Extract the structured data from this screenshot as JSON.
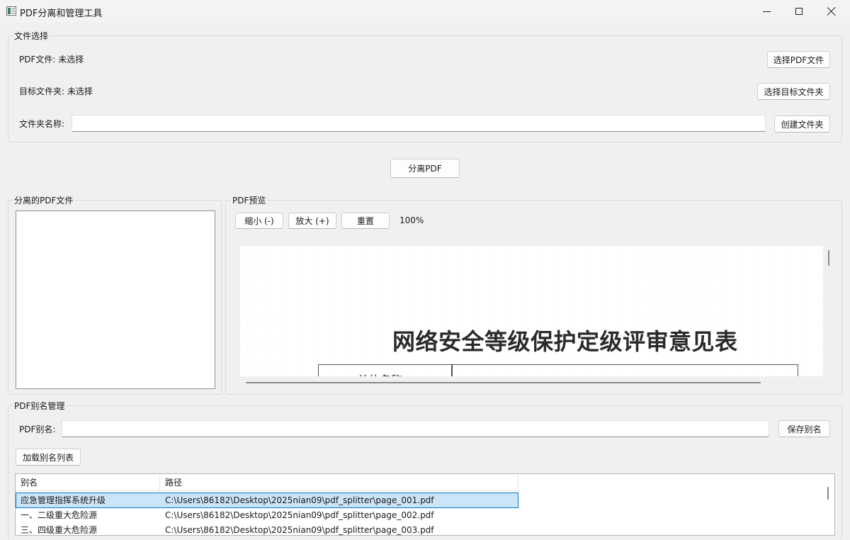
{
  "window": {
    "title": "PDF分离和管理工具"
  },
  "file_select": {
    "group_title": "文件选择",
    "pdf_file_label": "PDF文件: 未选择",
    "select_pdf_button": "选择PDF文件",
    "target_folder_label": "目标文件夹: 未选择",
    "select_target_button": "选择目标文件夹",
    "folder_name_label": "文件夹名称:",
    "folder_name_value": "",
    "create_folder_button": "创建文件夹"
  },
  "split_button": "分离PDF",
  "split_files": {
    "group_title": "分离的PDF文件",
    "items": []
  },
  "preview": {
    "group_title": "PDF预览",
    "zoom_out_button": "缩小 (-)",
    "zoom_in_button": "放大 (+)",
    "reset_button": "重置",
    "zoom_level": "100%",
    "document_title": "网络安全等级保护定级评审意见表",
    "document_cell_partial": "单位名称"
  },
  "alias": {
    "group_title": "PDF别名管理",
    "alias_label": "PDF别名:",
    "alias_value": "",
    "save_alias_button": "保存别名",
    "load_list_button": "加载别名列表",
    "table": {
      "columns": [
        "别名",
        "路径"
      ],
      "rows": [
        {
          "alias": "应急管理指挥系统升级",
          "path": "C:\\Users\\86182\\Desktop\\2025nian09\\pdf_splitter\\page_001.pdf",
          "selected": true
        },
        {
          "alias": "一、二级重大危险源",
          "path": "C:\\Users\\86182\\Desktop\\2025nian09\\pdf_splitter\\page_002.pdf",
          "selected": false
        },
        {
          "alias": "三、四级重大危险源",
          "path": "C:\\Users\\86182\\Desktop\\2025nian09\\pdf_splitter\\page_003.pdf",
          "selected": false
        }
      ]
    }
  }
}
